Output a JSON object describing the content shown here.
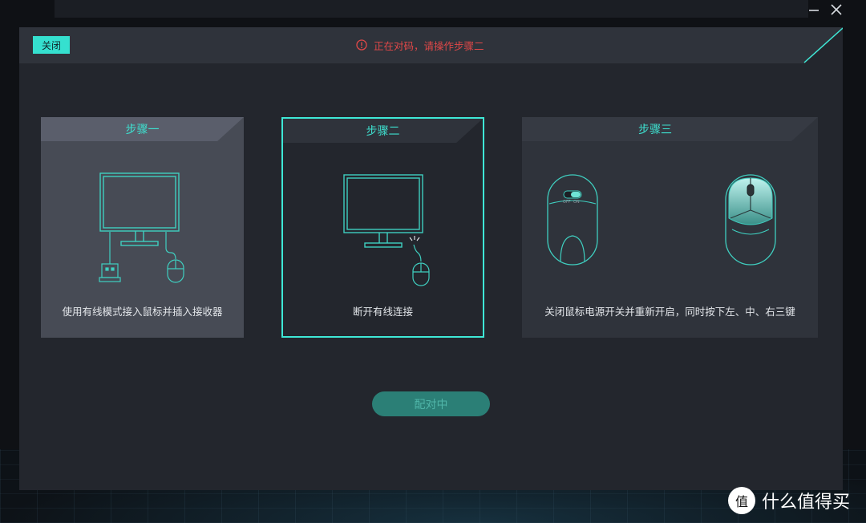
{
  "dialog": {
    "close_label": "关闭",
    "status_text": "正在对码，请操作步骤二"
  },
  "steps": [
    {
      "title": "步骤一",
      "caption": "使用有线模式接入鼠标并插入接收器"
    },
    {
      "title": "步骤二",
      "caption": "断开有线连接"
    },
    {
      "title": "步骤三",
      "caption": "关闭鼠标电源开关并重新开启，同时按下左、中、右三键"
    }
  ],
  "switch_labels": {
    "off": "OFF",
    "on": "ON"
  },
  "pair_button_label": "配对中",
  "watermark": {
    "text": "什么值得买",
    "logo_glyph": "值"
  },
  "icons": [
    "minimize-icon",
    "close-window-icon",
    "alert-circle-icon",
    "monitor-icon",
    "mouse-icon",
    "usb-receiver-icon",
    "disconnect-icon",
    "mouse-bottom-icon",
    "mouse-top-icon"
  ],
  "colors": {
    "accent": "#3ee8d6",
    "alert": "#e04848",
    "dialog_bg": "#23262d",
    "header_bg": "#2f333b",
    "pair_button": "#2b7f76"
  }
}
